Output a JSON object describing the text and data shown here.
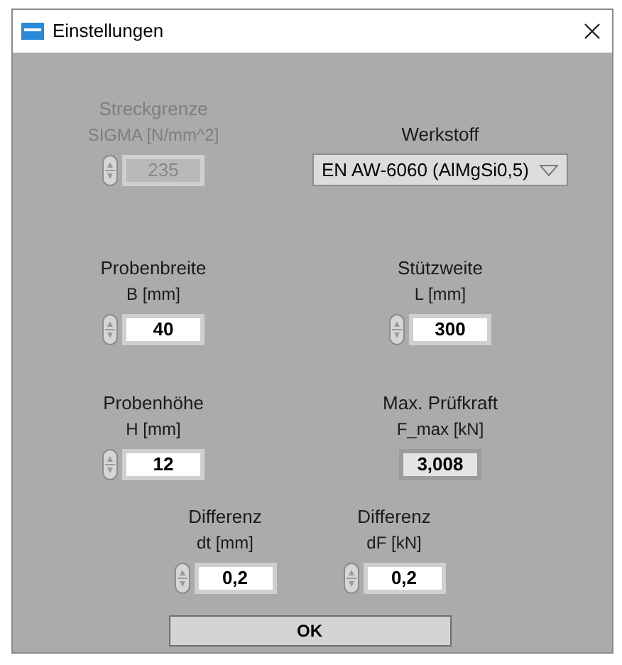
{
  "window": {
    "title": "Einstellungen"
  },
  "rows": [
    [
      {
        "kind": "numeric",
        "label": "Streckgrenze",
        "unit": "SIGMA [N/mm^2]",
        "value": "235",
        "disabled": true
      },
      {
        "kind": "dropdown",
        "label": "Werkstoff",
        "value": "EN AW-6060 (AlMgSi0,5)"
      }
    ],
    [
      {
        "kind": "numeric",
        "label": "Probenbreite",
        "unit": "B [mm]",
        "value": "40",
        "disabled": false
      },
      {
        "kind": "numeric",
        "label": "Stützweite",
        "unit": "L [mm]",
        "value": "300",
        "disabled": false
      }
    ],
    [
      {
        "kind": "numeric",
        "label": "Probenhöhe",
        "unit": "H [mm]",
        "value": "12",
        "disabled": false
      },
      {
        "kind": "indicator",
        "label": "Max. Prüfkraft",
        "unit": "F_max [kN]",
        "value": "3,008"
      }
    ],
    [
      {
        "kind": "numeric",
        "label": "Differenz",
        "unit": "dt [mm]",
        "value": "0,2",
        "disabled": false
      },
      {
        "kind": "numeric",
        "label": "Differenz",
        "unit": "dF [kN]",
        "value": "0,2",
        "disabled": false
      }
    ]
  ],
  "ok_button": "OK"
}
